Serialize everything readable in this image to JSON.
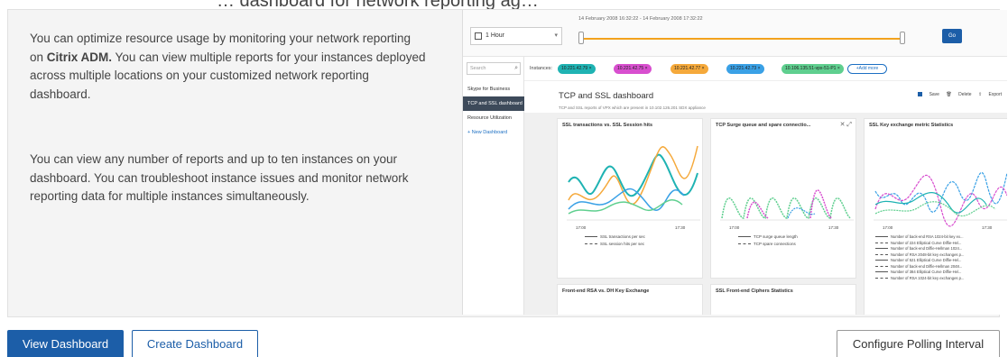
{
  "page": {
    "cropped_title": "… dashboard for network reporting ag…",
    "description_1_prefix": "You can optimize resource usage by monitoring your network reporting on ",
    "description_1_brand": "Citrix ADM.",
    "description_1_suffix": " You can view multiple reports for your instances deployed across multiple locations on your customized network reporting dashboard.",
    "description_2": "You can view any number of reports and up to ten instances on your dashboard. You can troubleshoot instance issues and monitor network reporting data for multiple instances simultaneously."
  },
  "actions": {
    "view_dashboard": "View Dashboard",
    "create_dashboard": "Create Dashboard",
    "configure_polling": "Configure Polling Interval"
  },
  "screenshot": {
    "time_select": "1 Hour",
    "time_range": "14 February 2008 16:32:22 - 14 February 2008 17:32:22",
    "go_label": "Go",
    "search_placeholder": "Search",
    "sidebar": [
      "Skype for Business",
      "TCP and SSL dashboard",
      "Resource Utilization",
      "+ New Dashboard"
    ],
    "instances_label": "Instances:",
    "instances": [
      {
        "label": "10.221.42.79 ×",
        "color": "#1fb3b3"
      },
      {
        "label": "10.221.42.75 ×",
        "color": "#d84fcf"
      },
      {
        "label": "10.221.42.77 ×",
        "color": "#f5a93b"
      },
      {
        "label": "10.221.42.73 ×",
        "color": "#3aa1e6"
      },
      {
        "label": "10.106.135.51-vpx-51-P1 ×",
        "color": "#5fcf8f"
      }
    ],
    "add_more": "+Add more",
    "dashboard_title": "TCP and SSL dashboard",
    "dashboard_subtitle": "TCP and SSL reports of VPX which are present in 10.102.126.201 SDX appliance",
    "save": "Save",
    "delete": "Delete",
    "export": "Export",
    "cards": {
      "card1_title": "SSL transactions vs. SSL Session hits",
      "card1_legend_1": "SSL transactions per sec",
      "card1_legend_2": "SSL session hits per sec",
      "card1_tick": "17:00",
      "card1_tick2": "17:30",
      "card2_title": "TCP Surge queue and spare connectio...",
      "card2_legend_1": "TCP surge queue length",
      "card2_legend_2": "TCP spare connections",
      "card2_tick": "17:00",
      "card2_tick2": "17:30",
      "card3_title": "SSL Key exchange metric Statistics",
      "card3_tick": "17:00",
      "card3_tick2": "17:30",
      "card3_legend": [
        "Number of back-end RSA 1024-bit key ex...",
        "Number of 224 Elliptical Curve Diffie-Hel...",
        "Number of back-end Diffie-Hellman 1024...",
        "Number of RSA 2048-bit key exchanges p...",
        "Number of 521 Elliptical Curve Diffie-Hel...",
        "Number of back-end Diffie-Hellman 2048...",
        "Number of 384 Elliptical Curve Diffie-Hel...",
        "Number of RSA 1024-bit key exchanges p..."
      ],
      "card4_title": "Front-end RSA vs. DH Key Exchange",
      "card5_title": "SSL Front-end Ciphers Statistics"
    },
    "colors": {
      "teal": "#1fb3b3",
      "magenta": "#d84fcf",
      "orange": "#f5a93b",
      "blue": "#3aa1e6",
      "green": "#5fcf8f",
      "primary": "#1c5ea8"
    }
  }
}
